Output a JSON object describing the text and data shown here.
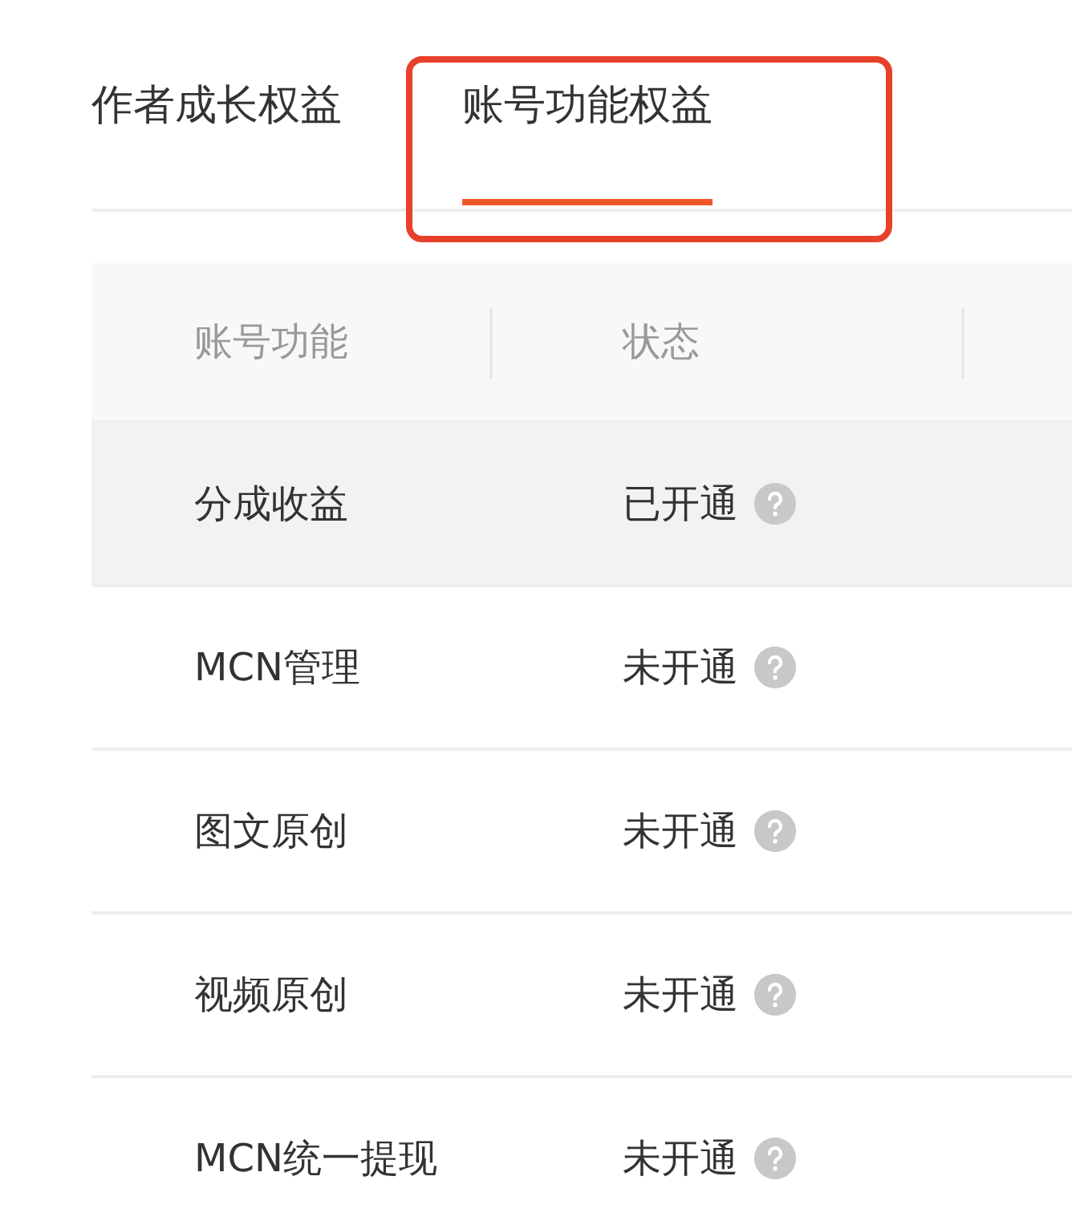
{
  "tabs": [
    {
      "label": "作者成长权益",
      "selected": false,
      "outlined": false
    },
    {
      "label": "账号功能权益",
      "selected": true,
      "outlined": true
    }
  ],
  "table": {
    "columns": [
      "账号功能",
      "状态"
    ],
    "rows": [
      {
        "feature": "分成收益",
        "status": "已开通",
        "hovered": true
      },
      {
        "feature": "MCN管理",
        "status": "未开通",
        "hovered": false
      },
      {
        "feature": "图文原创",
        "status": "未开通",
        "hovered": false
      },
      {
        "feature": "视频原创",
        "status": "未开通",
        "hovered": false
      },
      {
        "feature": "MCN统一提现",
        "status": "未开通",
        "hovered": false
      }
    ]
  }
}
